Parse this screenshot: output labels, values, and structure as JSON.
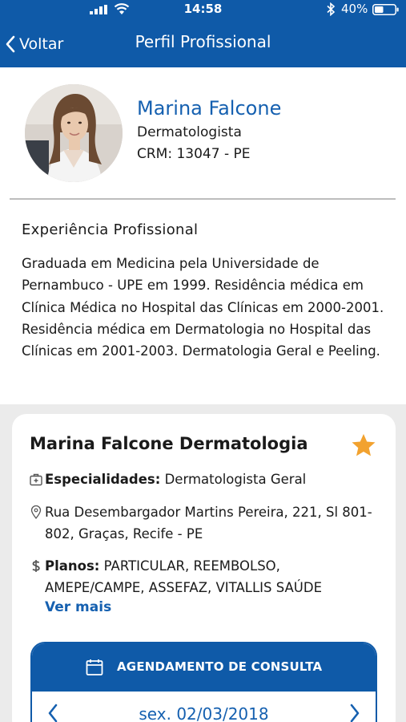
{
  "status_bar": {
    "time": "14:58",
    "battery": "40%",
    "icons": [
      "signal-icon",
      "wifi-icon",
      "bluetooth-icon",
      "battery-icon"
    ]
  },
  "nav": {
    "back_label": "Voltar",
    "title": "Perfil Profissional"
  },
  "doctor": {
    "name": "Marina Falcone",
    "specialty": "Dermatologista",
    "crm": "CRM: 13047 - PE"
  },
  "experience": {
    "title": "Experiência Profissional",
    "text": "Graduada em Medicina pela Universidade de Pernambuco - UPE em 1999. Residência médica em Clínica Médica no Hospital das Clínicas em 2000-2001. Residência médica em Dermatologia no Hospital das Clínicas em 2001-2003. Dermatologia Geral e Peeling."
  },
  "clinic": {
    "name": "Marina Falcone Dermatologia",
    "favorite": true,
    "specialties_label": "Especialidades:",
    "specialties_value": "Dermatologista Geral",
    "address": "Rua Desembargador Martins Pereira, 221, Sl 801-802, Graças, Recife - PE",
    "plans_label": "Planos:",
    "plans_value": "PARTICULAR, REEMBOLSO, AMEPE/CAMPE, ASSEFAZ, VITALLIS SAÚDE",
    "see_more": "Ver mais"
  },
  "scheduling": {
    "title": "AGENDAMENTO DE CONSULTA",
    "date": "sex. 02/03/2018"
  },
  "colors": {
    "brand_blue": "#0f5aa8",
    "link_blue": "#1560b0",
    "star": "#f2a22f",
    "background": "#ebebeb"
  }
}
